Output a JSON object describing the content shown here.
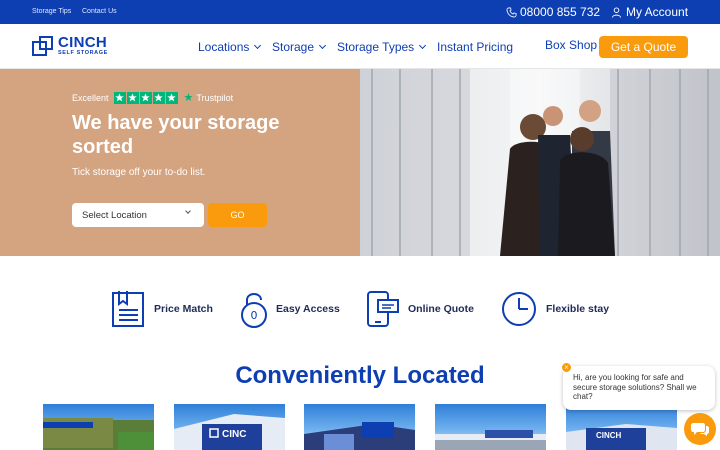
{
  "topbar": {
    "links": [
      "Storage Tips",
      "Contact Us"
    ],
    "phone": "08000 855 732",
    "account": "My Account"
  },
  "nav": {
    "logo_main": "CINCH",
    "logo_sub": "SELF STORAGE",
    "items": [
      {
        "label": "Locations",
        "dropdown": true
      },
      {
        "label": "Storage",
        "dropdown": true
      },
      {
        "label": "Storage Types",
        "dropdown": true
      },
      {
        "label": "Instant Pricing",
        "dropdown": false
      },
      {
        "label": "Box Shop",
        "dropdown": false
      }
    ],
    "cta": "Get a Quote"
  },
  "hero": {
    "rating_label": "Excellent",
    "rating_stars": 5,
    "trustpilot": "Trustpilot",
    "title": "We have your storage sorted",
    "subtitle": "Tick storage off your to-do list.",
    "select_placeholder": "Select Location",
    "go_label": "GO"
  },
  "features": [
    {
      "icon": "price-match-icon",
      "label": "Price Match"
    },
    {
      "icon": "padlock-icon",
      "label": "Easy Access"
    },
    {
      "icon": "online-quote-icon",
      "label": "Online Quote"
    },
    {
      "icon": "clock-icon",
      "label": "Flexible stay"
    }
  ],
  "locations_title": "Conveniently Located",
  "chat": {
    "message": "Hi, are you looking for safe and secure storage solutions? Shall we chat?",
    "close": "×"
  },
  "colors": {
    "brand_blue": "#0d3fb3",
    "accent_orange": "#f99b0c",
    "hero_tan": "#d4a380",
    "trustpilot_green": "#00b67a"
  }
}
